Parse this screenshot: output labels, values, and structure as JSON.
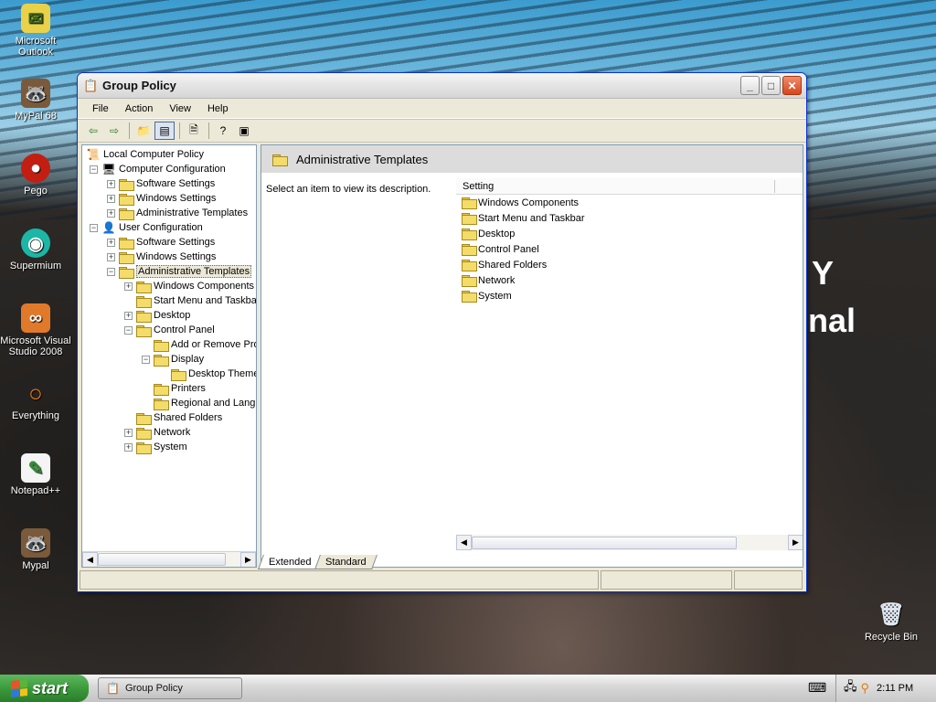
{
  "desktop": {
    "icons": [
      {
        "label": "Microsoft\nOutlook",
        "icon": "outlook-icon"
      },
      {
        "label": "MyPal 68",
        "icon": "mypal-icon"
      },
      {
        "label": "Pego",
        "icon": "pego-icon"
      },
      {
        "label": "Supermium",
        "icon": "supermium-icon"
      },
      {
        "label": "Microsoft Visual Studio 2008",
        "icon": "visual-studio-icon"
      },
      {
        "label": "Everything",
        "icon": "everything-icon"
      },
      {
        "label": "Notepad++",
        "icon": "notepadpp-icon"
      },
      {
        "label": "Mypal",
        "icon": "mypal-icon"
      },
      {
        "label": "Recycle Bin",
        "icon": "recycle-bin-icon"
      }
    ],
    "wallpaper_text": [
      "Y",
      "nal"
    ]
  },
  "window": {
    "title": "Group Policy",
    "menu": [
      "File",
      "Action",
      "View",
      "Help"
    ],
    "toolbar": [
      "back",
      "forward",
      "up-folder",
      "show-hide-tree",
      "export-list",
      "help",
      "properties"
    ]
  },
  "tree": {
    "items": [
      {
        "label": "Local Computer Policy",
        "icon": "policy-icon",
        "expander": ""
      },
      {
        "label": "Computer Configuration",
        "icon": "computer-icon",
        "expander": "−"
      },
      {
        "label": "Software Settings",
        "icon": "folder-icon",
        "expander": "+"
      },
      {
        "label": "Windows Settings",
        "icon": "folder-icon",
        "expander": "+"
      },
      {
        "label": "Administrative Templates",
        "icon": "folder-icon",
        "expander": "+"
      },
      {
        "label": "User Configuration",
        "icon": "user-icon",
        "expander": "−"
      },
      {
        "label": "Software Settings",
        "icon": "folder-icon",
        "expander": "+"
      },
      {
        "label": "Windows Settings",
        "icon": "folder-icon",
        "expander": "+"
      },
      {
        "label": "Administrative Templates",
        "icon": "folder-icon",
        "expander": "−"
      },
      {
        "label": "Windows Components",
        "icon": "folder-icon",
        "expander": "+"
      },
      {
        "label": "Start Menu and Taskba",
        "icon": "folder-icon",
        "expander": ""
      },
      {
        "label": "Desktop",
        "icon": "folder-icon",
        "expander": "+"
      },
      {
        "label": "Control Panel",
        "icon": "folder-icon",
        "expander": "−"
      },
      {
        "label": "Add or Remove Pro",
        "icon": "folder-icon",
        "expander": ""
      },
      {
        "label": "Display",
        "icon": "folder-icon",
        "expander": "−"
      },
      {
        "label": "Desktop Theme",
        "icon": "folder-icon",
        "expander": ""
      },
      {
        "label": "Printers",
        "icon": "folder-icon",
        "expander": ""
      },
      {
        "label": "Regional and Langu",
        "icon": "folder-icon",
        "expander": ""
      },
      {
        "label": "Shared Folders",
        "icon": "folder-icon",
        "expander": ""
      },
      {
        "label": "Network",
        "icon": "folder-icon",
        "expander": "+"
      },
      {
        "label": "System",
        "icon": "folder-icon",
        "expander": "+"
      }
    ],
    "selected_index": 8
  },
  "details": {
    "header": "Administrative Templates",
    "description": "Select an item to view its description.",
    "column": "Setting",
    "items": [
      "Windows Components",
      "Start Menu and Taskbar",
      "Desktop",
      "Control Panel",
      "Shared Folders",
      "Network",
      "System"
    ]
  },
  "tabs": [
    "Extended",
    "Standard"
  ],
  "taskbar": {
    "start_label": "start",
    "task_label": "Group Policy",
    "clock": "2:11 PM"
  }
}
